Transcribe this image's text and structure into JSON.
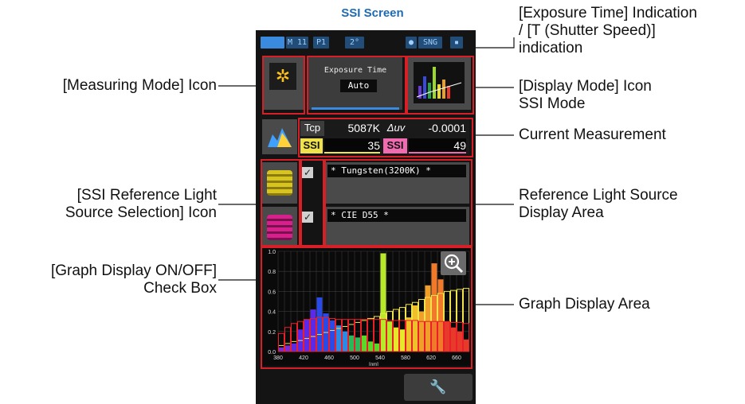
{
  "title": "SSI Screen",
  "annotations": {
    "exposure_time_indication": "[Exposure Time] Indication\n/ [T (Shutter Speed)]\nindication",
    "measuring_mode_icon": "[Measuring Mode] Icon",
    "display_mode_icon": "[Display Mode] Icon\nSSI Mode",
    "current_measurement": "Current Measurement",
    "ssi_reference_selection_icon": "[SSI Reference Light\nSource Selection] Icon",
    "reference_light_display_area": "Reference Light Source\nDisplay Area",
    "graph_display_checkbox": "[Graph Display ON/OFF]\nCheck Box",
    "graph_display_area": "Graph Display Area"
  },
  "device": {
    "status": {
      "mode": "M 11",
      "preset": "P1",
      "angle": "2°",
      "sync": "SNG"
    },
    "exposure": {
      "label": "Exposure Time",
      "value": "Auto"
    },
    "measurement": {
      "tcp_label": "Tcp",
      "tcp_value": "5087K",
      "duv_label": "Δuv",
      "duv_value": "-0.0001",
      "ssi1_label": "SSI",
      "ssi1_value": "35",
      "ssi2_label": "SSI",
      "ssi2_value": "49"
    },
    "references": [
      {
        "name": "* Tungsten(3200K) *",
        "checked": true,
        "color": "#d8c41e"
      },
      {
        "name": "* CIE D55 *",
        "checked": true,
        "color": "#d8208c"
      }
    ],
    "colors": {
      "highlight_red": "#d61f26",
      "title_blue": "#1d6bb5"
    }
  },
  "chart_data": {
    "type": "bar",
    "xlabel": "[nm]",
    "ylabel": "",
    "xlim": [
      380,
      680
    ],
    "ylim": [
      0.0,
      1.0
    ],
    "x_ticks": [
      380,
      420,
      460,
      500,
      540,
      580,
      620,
      660
    ],
    "y_ticks": [
      "0.0",
      "0.2",
      "0.4",
      "0.6",
      "0.8",
      "1.0"
    ],
    "series": [
      {
        "name": "",
        "x": [
          380,
          390,
          400,
          410,
          420,
          430,
          440,
          450,
          460,
          470,
          480,
          490,
          500,
          510,
          520,
          530,
          540,
          550,
          560,
          570,
          580,
          590,
          600,
          610,
          620,
          630,
          640,
          650,
          660,
          670
        ],
        "values": [
          0.04,
          0.06,
          0.08,
          0.22,
          0.32,
          0.42,
          0.54,
          0.38,
          0.31,
          0.26,
          0.2,
          0.16,
          0.14,
          0.16,
          0.1,
          0.08,
          0.98,
          0.3,
          0.24,
          0.22,
          0.34,
          0.46,
          0.4,
          0.66,
          0.88,
          0.72,
          0.3,
          0.24,
          0.2,
          0.12
        ]
      },
      {
        "name": "",
        "values": [
          0.06,
          0.08,
          0.1,
          0.11,
          0.13,
          0.15,
          0.17,
          0.19,
          0.21,
          0.23,
          0.25,
          0.27,
          0.29,
          0.31,
          0.33,
          0.35,
          0.38,
          0.4,
          0.42,
          0.44,
          0.47,
          0.49,
          0.52,
          0.54,
          0.56,
          0.58,
          0.6,
          0.61,
          0.62,
          0.63
        ]
      },
      {
        "name": "",
        "values": [
          0.18,
          0.24,
          0.28,
          0.3,
          0.32,
          0.33,
          0.34,
          0.34,
          0.33,
          0.32,
          0.32,
          0.32,
          0.32,
          0.32,
          0.32,
          0.32,
          0.32,
          0.31,
          0.31,
          0.31,
          0.31,
          0.31,
          0.3,
          0.3,
          0.3,
          0.3,
          0.3,
          0.29,
          0.29,
          0.28
        ]
      }
    ]
  }
}
